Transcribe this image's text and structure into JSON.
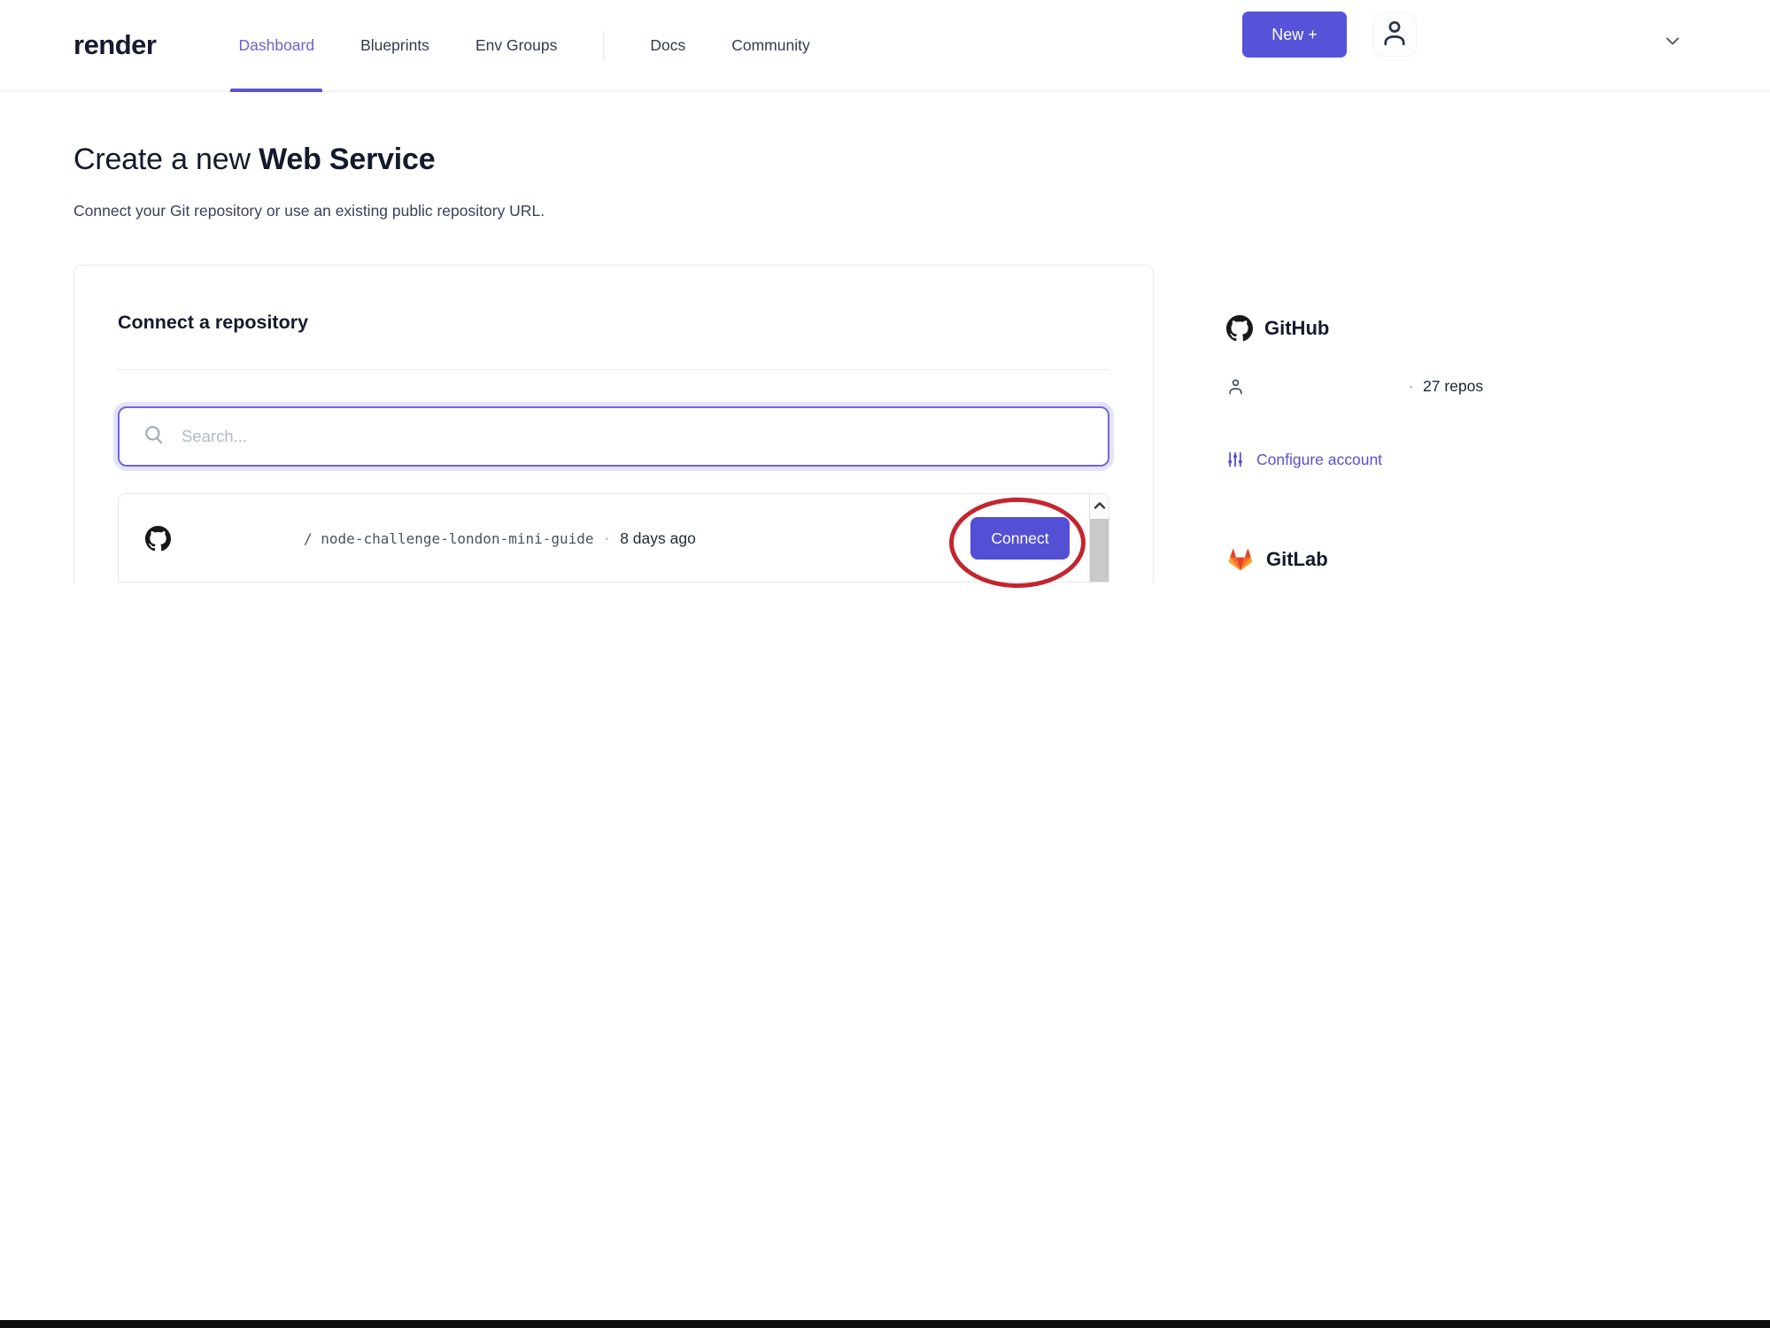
{
  "header": {
    "logo": "render",
    "nav": [
      {
        "label": "Dashboard",
        "active": true
      },
      {
        "label": "Blueprints",
        "active": false
      },
      {
        "label": "Env Groups",
        "active": false
      },
      {
        "label": "Docs",
        "active": false
      },
      {
        "label": "Community",
        "active": false
      }
    ],
    "new_button_label": "New +"
  },
  "page": {
    "title_prefix": "Create a new ",
    "title_emphasis": "Web Service",
    "subtitle": "Connect your Git repository or use an existing public repository URL."
  },
  "connect_card": {
    "heading": "Connect a repository",
    "search": {
      "placeholder": "Search..."
    },
    "repo_row": {
      "path_slash": "/",
      "repo_name": "node-challenge-london-mini-guide",
      "dot": "·",
      "updated": "8 days ago",
      "connect_label": "Connect"
    }
  },
  "sidebar": {
    "github": {
      "title": "GitHub",
      "dot": "·",
      "repo_count": "27 repos",
      "configure_label": "Configure account"
    },
    "gitlab": {
      "title": "GitLab"
    }
  },
  "colors": {
    "accent": "#5450d5",
    "annotation_red": "#c4252e",
    "gitlab_orange": "#e24329"
  }
}
